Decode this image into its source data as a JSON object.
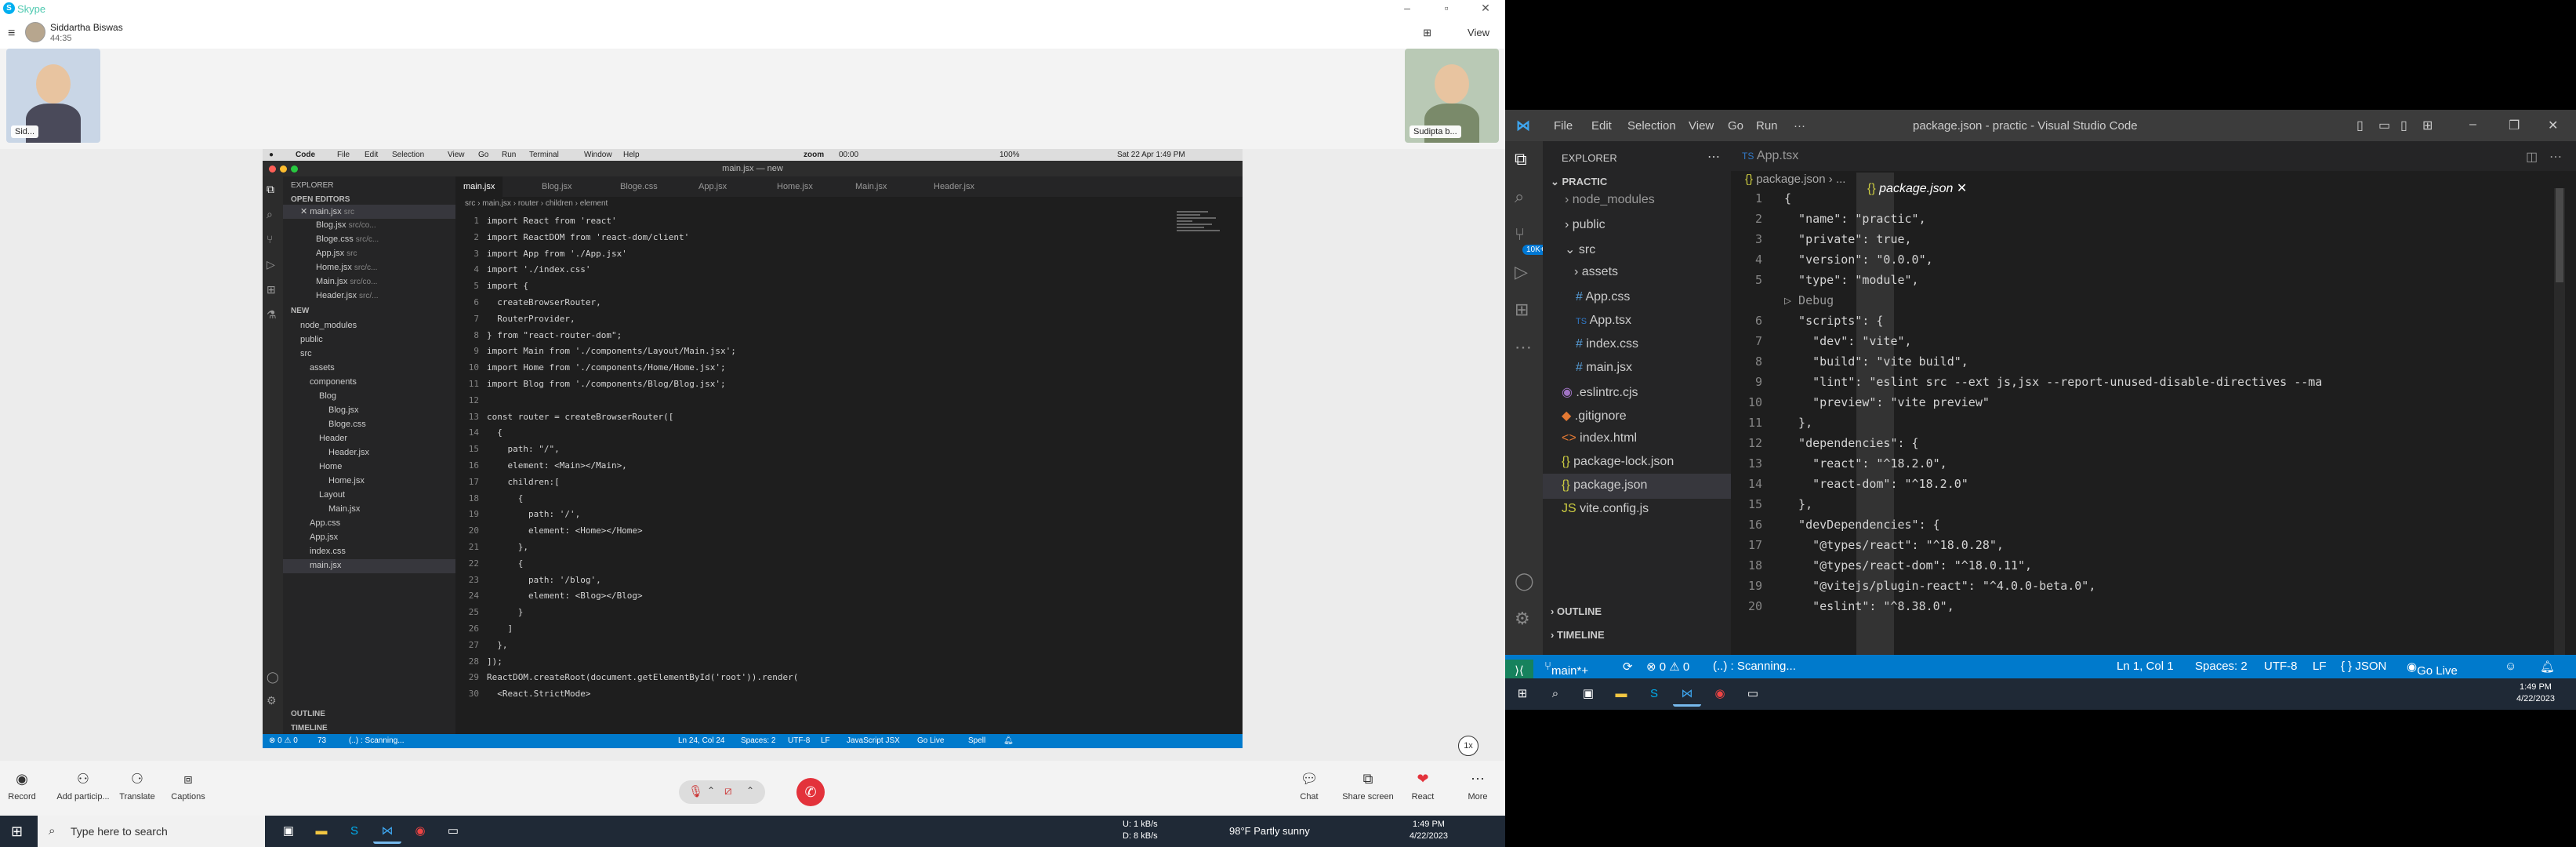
{
  "skype": {
    "app_title": "Skype",
    "view_label": "View",
    "caller_name": "Siddartha Biswas",
    "call_duration": "44:35",
    "self_tile_label": "Sid...",
    "remote_tile_label": "Sudipta b...",
    "controls": {
      "record": "Record",
      "add_participant": "Add particip...",
      "translate": "Translate",
      "captions": "Captions",
      "chat": "Chat",
      "share_screen": "Share screen",
      "react": "React",
      "more": "More"
    },
    "zoom_label": "1x"
  },
  "shared_screen": {
    "menubar": {
      "app": "Code",
      "items": [
        "File",
        "Edit",
        "Selection",
        "View",
        "Go",
        "Run",
        "Terminal",
        "Window",
        "Help"
      ],
      "zoom_label": "zoom",
      "zoom_timer": "00:00",
      "battery": "100%",
      "datetime": "Sat 22 Apr 1:49 PM"
    },
    "window_title": "main.jsx — new",
    "sidebar": {
      "header": "EXPLORER",
      "open_editors_header": "OPEN EDITORS",
      "open_editors": [
        {
          "name": "main.jsx",
          "desc": "src"
        },
        {
          "name": "Blog.jsx",
          "desc": "src/co..."
        },
        {
          "name": "Bloge.css",
          "desc": "src/c..."
        },
        {
          "name": "App.jsx",
          "desc": "src"
        },
        {
          "name": "Home.jsx",
          "desc": "src/c..."
        },
        {
          "name": "Main.jsx",
          "desc": "src/co..."
        },
        {
          "name": "Header.jsx",
          "desc": "src/..."
        }
      ],
      "project_header": "NEW",
      "tree": [
        "node_modules",
        "public",
        "src",
        "assets",
        "components",
        "Blog",
        "Blog.jsx",
        "Bloge.css",
        "Header",
        "Header.jsx",
        "Home",
        "Home.jsx",
        "Layout",
        "Main.jsx",
        "App.css",
        "App.jsx",
        "index.css",
        "main.jsx"
      ],
      "outline": "OUTLINE",
      "timeline": "TIMELINE"
    },
    "tabs": [
      "main.jsx",
      "Blog.jsx",
      "Bloge.css",
      "App.jsx",
      "Home.jsx",
      "Main.jsx",
      "Header.jsx"
    ],
    "breadcrumb": [
      "src",
      "main.jsx",
      "router",
      "children",
      "element"
    ],
    "code_lines": [
      "import React from 'react'",
      "import ReactDOM from 'react-dom/client'",
      "import App from './App.jsx'",
      "import './index.css'",
      "import {",
      "  createBrowserRouter,",
      "  RouterProvider,",
      "} from \"react-router-dom\";",
      "import Main from './components/Layout/Main.jsx';",
      "import Home from './components/Home/Home.jsx';",
      "import Blog from './components/Blog/Blog.jsx';",
      "",
      "const router = createBrowserRouter([",
      "  {",
      "    path: \"/\",",
      "    element: <Main></Main>,",
      "    children:[",
      "      {",
      "        path: '/',",
      "        element: <Home></Home>",
      "      },",
      "      {",
      "        path: '/blog',",
      "        element: <Blog></Blog>",
      "      }",
      "    ]",
      "  },",
      "]);",
      "ReactDOM.createRoot(document.getElementById('root')).render(",
      "  <React.StrictMode>"
    ],
    "status": {
      "errors": "⊗ 0 ⚠ 0",
      "info": "73",
      "scanning": "(..) : Scanning...",
      "position": "Ln 24, Col 24",
      "spaces": "Spaces: 2",
      "encoding": "UTF-8",
      "eol": "LF",
      "language": "JavaScript JSX",
      "go_live": "Go Live",
      "spell": "Spell"
    }
  },
  "taskbar_left": {
    "search_placeholder": "Type here to search",
    "net_up": "U:      1 kB/s",
    "net_down": "D:      8 kB/s",
    "weather": "98°F  Partly sunny",
    "time": "1:49 PM",
    "date": "4/22/2023"
  },
  "vscode": {
    "menu": [
      "File",
      "Edit",
      "Selection",
      "View",
      "Go",
      "Run",
      "···"
    ],
    "window_title": "package.json - practic - Visual Studio Code",
    "sidebar": {
      "header": "EXPLORER",
      "project": "PRACTIC",
      "items": [
        {
          "name": "node_modules",
          "kind": "folder"
        },
        {
          "name": "public",
          "kind": "folder"
        },
        {
          "name": "src",
          "kind": "folder-open"
        },
        {
          "name": "assets",
          "kind": "folder"
        },
        {
          "name": "App.css",
          "kind": "css"
        },
        {
          "name": "App.tsx",
          "kind": "ts"
        },
        {
          "name": "index.css",
          "kind": "css"
        },
        {
          "name": "main.jsx",
          "kind": "css"
        },
        {
          "name": ".eslintrc.cjs",
          "kind": "eslint"
        },
        {
          "name": ".gitignore",
          "kind": "git"
        },
        {
          "name": "index.html",
          "kind": "html"
        },
        {
          "name": "package-lock.json",
          "kind": "json"
        },
        {
          "name": "package.json",
          "kind": "json"
        },
        {
          "name": "vite.config.js",
          "kind": "js"
        }
      ],
      "outline": "OUTLINE",
      "timeline": "TIMELINE",
      "scm_badge": "10K+"
    },
    "tabs": [
      {
        "name": "App.tsx",
        "icon": "TS"
      },
      {
        "name": "package.json",
        "icon": "{}"
      }
    ],
    "breadcrumb": [
      "package.json",
      "..."
    ],
    "debug_label": "▷ Debug",
    "code_lines": [
      "{",
      "  \"name\": \"practic\",",
      "  \"private\": true,",
      "  \"version\": \"0.0.0\",",
      "  \"type\": \"module\",",
      "  \"scripts\": {",
      "    \"dev\": \"vite\",",
      "    \"build\": \"vite build\",",
      "    \"lint\": \"eslint src --ext js,jsx --report-unused-disable-directives --ma",
      "    \"preview\": \"vite preview\"",
      "  },",
      "  \"dependencies\": {",
      "    \"react\": \"^18.2.0\",",
      "    \"react-dom\": \"^18.2.0\"",
      "  },",
      "  \"devDependencies\": {",
      "    \"@types/react\": \"^18.0.28\",",
      "    \"@types/react-dom\": \"^18.0.11\",",
      "    \"@vitejs/plugin-react\": \"^4.0.0-beta.0\",",
      "    \"eslint\": \"^8.38.0\","
    ],
    "status": {
      "branch": "main*+",
      "problems": "⊗ 0 ⚠ 0",
      "scanning": "(..) : Scanning...",
      "position": "Ln 1, Col 1",
      "spaces": "Spaces: 2",
      "encoding": "UTF-8",
      "eol": "LF",
      "language": "{ } JSON",
      "go_live": "Go Live"
    }
  },
  "taskbar_right": {
    "time": "1:49 PM",
    "date": "4/22/2023"
  }
}
